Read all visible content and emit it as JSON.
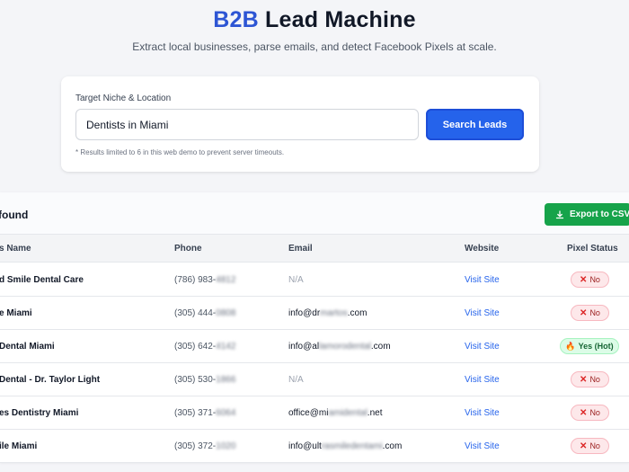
{
  "header": {
    "title_accent": "B2B",
    "title_rest": " Lead Machine",
    "subtitle": "Extract local businesses, parse emails, and detect Facebook Pixels at scale."
  },
  "search": {
    "label": "Target Niche & Location",
    "value": "Dentists in Miami",
    "button": "Search Leads",
    "note": "* Results limited to 6 in this web demo to prevent server timeouts."
  },
  "results": {
    "title": "found",
    "export_label": "Export to CSV",
    "columns": [
      "s Name",
      "Phone",
      "Email",
      "Website",
      "Pixel Status"
    ],
    "rows": [
      {
        "name": "d Smile Dental Care",
        "phone_prefix": "(786) 983-",
        "phone_hidden": "4812",
        "email_prefix": "N/A",
        "email_hidden": "",
        "email_suffix": "",
        "website": "Visit Site",
        "pixel": "No"
      },
      {
        "name": "e Miami",
        "phone_prefix": "(305) 444-",
        "phone_hidden": "0808",
        "email_prefix": "info@dr",
        "email_hidden": "martos",
        "email_suffix": ".com",
        "website": "Visit Site",
        "pixel": "No"
      },
      {
        "name": "Dental Miami",
        "phone_prefix": "(305) 642-",
        "phone_hidden": "4142",
        "email_prefix": "info@al",
        "email_hidden": "lamorodental",
        "email_suffix": ".com",
        "website": "Visit Site",
        "pixel": "Yes (Hot)"
      },
      {
        "name": "Dental - Dr. Taylor Light",
        "phone_prefix": "(305) 530-",
        "phone_hidden": "1866",
        "email_prefix": "N/A",
        "email_hidden": "",
        "email_suffix": "",
        "website": "Visit Site",
        "pixel": "No"
      },
      {
        "name": "es Dentistry Miami",
        "phone_prefix": "(305) 371-",
        "phone_hidden": "6064",
        "email_prefix": "office@mi",
        "email_hidden": "amidental",
        "email_suffix": ".net",
        "website": "Visit Site",
        "pixel": "No"
      },
      {
        "name": "ile Miami",
        "phone_prefix": "(305) 372-",
        "phone_hidden": "1020",
        "email_prefix": "info@ult",
        "email_hidden": "rasmiledentami",
        "email_suffix": ".com",
        "website": "Visit Site",
        "pixel": "No"
      }
    ]
  },
  "colors": {
    "accent": "#2d55d4",
    "primary_button": "#2563eb",
    "export_button": "#16a34a",
    "badge_no": "#fde8ea",
    "badge_hot": "#dcfce7"
  },
  "icons": {
    "export": "download-icon",
    "no": "x-icon",
    "hot": "flame-icon"
  }
}
